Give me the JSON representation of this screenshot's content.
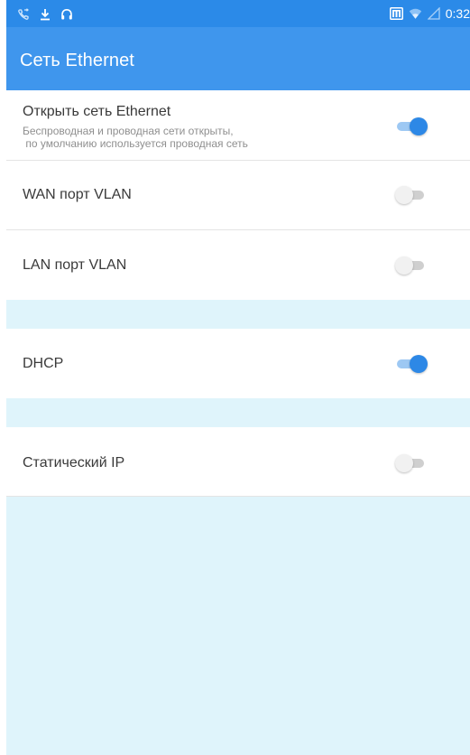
{
  "status_bar": {
    "time": "0:32",
    "left_icons": [
      "call-forward-icon",
      "download-icon",
      "headset-icon"
    ],
    "right_icons": [
      "gallery-icon",
      "wifi-icon",
      "signal-icon"
    ]
  },
  "app_bar": {
    "title": "Сеть Ethernet"
  },
  "settings": {
    "open_ethernet": {
      "title": "Открыть сеть Ethernet",
      "subtitle_line1": "Беспроводная и проводная сети открыты,",
      "subtitle_line2": " по умолчанию используется проводная сеть",
      "enabled": true
    },
    "wan_vlan": {
      "title": "WAN порт VLAN",
      "enabled": false
    },
    "lan_vlan": {
      "title": "LAN порт VLAN",
      "enabled": false
    },
    "dhcp": {
      "title": "DHCP",
      "enabled": true
    },
    "static_ip": {
      "title": "Статический IP",
      "enabled": false
    }
  },
  "colors": {
    "status_bar": "#2b8ae8",
    "app_bar": "#3f96ed",
    "background": "#dff4fb",
    "switch_on": "#2d88e6",
    "switch_off": "#f1f1f1"
  }
}
